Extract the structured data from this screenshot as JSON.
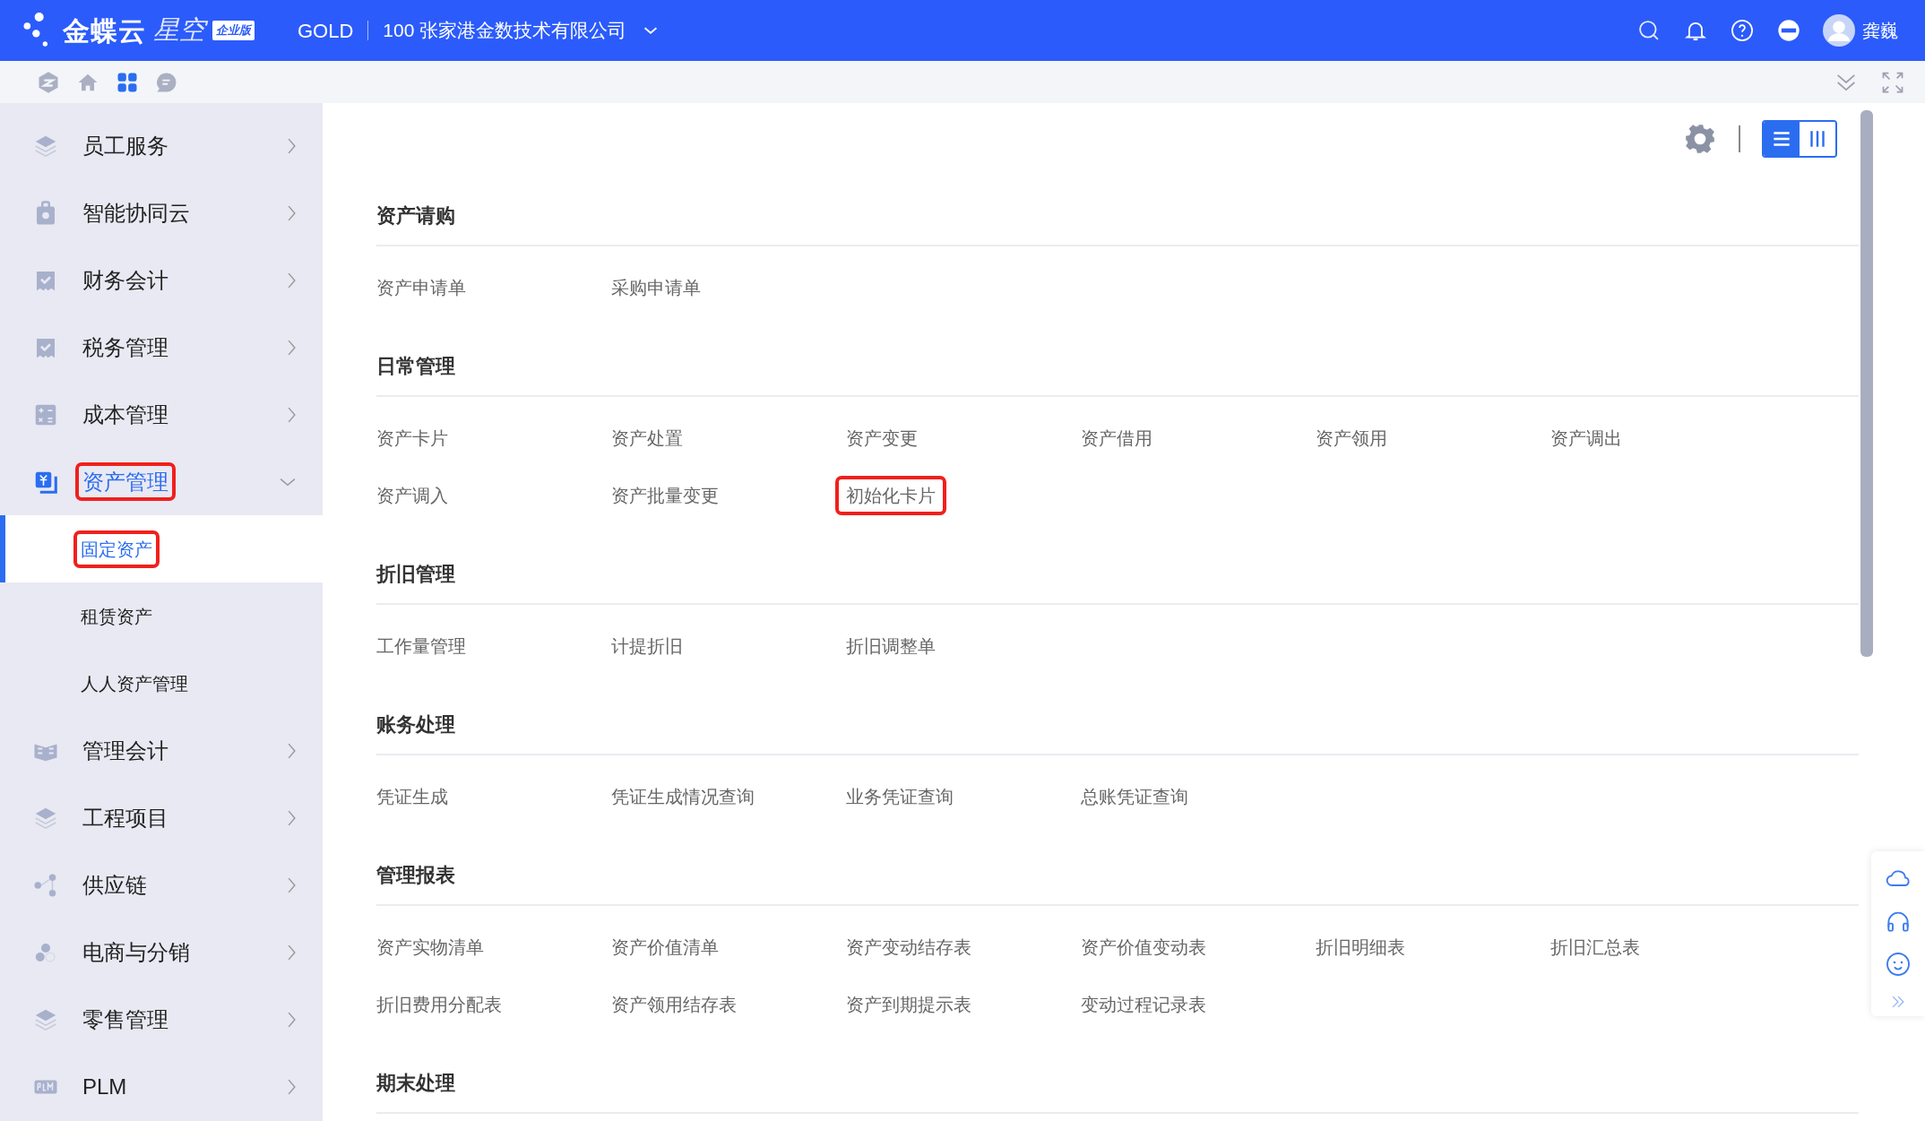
{
  "header": {
    "brand": "金蝶云",
    "product": "星空",
    "edition": "企业版",
    "tier": "GOLD",
    "company": "100 张家港金数技术有限公司",
    "user": "龚巍"
  },
  "sidebar": {
    "items": [
      {
        "label": "员工服务",
        "expanded": false,
        "annotated": false
      },
      {
        "label": "智能协同云",
        "expanded": false,
        "annotated": false
      },
      {
        "label": "财务会计",
        "expanded": false,
        "annotated": false
      },
      {
        "label": "税务管理",
        "expanded": false,
        "annotated": false
      },
      {
        "label": "成本管理",
        "expanded": false,
        "annotated": false
      },
      {
        "label": "资产管理",
        "expanded": true,
        "annotated": true,
        "children": [
          {
            "label": "固定资产",
            "selected": true,
            "annotated": true
          },
          {
            "label": "租赁资产",
            "selected": false,
            "annotated": false
          },
          {
            "label": "人人资产管理",
            "selected": false,
            "annotated": false
          }
        ]
      },
      {
        "label": "管理会计",
        "expanded": false,
        "annotated": false
      },
      {
        "label": "工程项目",
        "expanded": false,
        "annotated": false
      },
      {
        "label": "供应链",
        "expanded": false,
        "annotated": false
      },
      {
        "label": "电商与分销",
        "expanded": false,
        "annotated": false
      },
      {
        "label": "零售管理",
        "expanded": false,
        "annotated": false
      },
      {
        "label": "PLM",
        "expanded": false,
        "annotated": false
      }
    ]
  },
  "view_toggle": [
    {
      "kind": "list",
      "selected": true
    },
    {
      "kind": "columns",
      "selected": false
    }
  ],
  "sections": [
    {
      "title": "资产请购",
      "links": [
        {
          "label": "资产申请单",
          "annotated": false
        },
        {
          "label": "采购申请单",
          "annotated": false
        }
      ]
    },
    {
      "title": "日常管理",
      "links": [
        {
          "label": "资产卡片",
          "annotated": false
        },
        {
          "label": "资产处置",
          "annotated": false
        },
        {
          "label": "资产变更",
          "annotated": false
        },
        {
          "label": "资产借用",
          "annotated": false
        },
        {
          "label": "资产领用",
          "annotated": false
        },
        {
          "label": "资产调出",
          "annotated": false
        },
        {
          "label": "资产调入",
          "annotated": false
        },
        {
          "label": "资产批量变更",
          "annotated": false
        },
        {
          "label": "初始化卡片",
          "annotated": true
        }
      ]
    },
    {
      "title": "折旧管理",
      "links": [
        {
          "label": "工作量管理",
          "annotated": false
        },
        {
          "label": "计提折旧",
          "annotated": false
        },
        {
          "label": "折旧调整单",
          "annotated": false
        }
      ]
    },
    {
      "title": "账务处理",
      "links": [
        {
          "label": "凭证生成",
          "annotated": false
        },
        {
          "label": "凭证生成情况查询",
          "annotated": false
        },
        {
          "label": "业务凭证查询",
          "annotated": false
        },
        {
          "label": "总账凭证查询",
          "annotated": false
        }
      ]
    },
    {
      "title": "管理报表",
      "links": [
        {
          "label": "资产实物清单",
          "annotated": false
        },
        {
          "label": "资产价值清单",
          "annotated": false
        },
        {
          "label": "资产变动结存表",
          "annotated": false
        },
        {
          "label": "资产价值变动表",
          "annotated": false
        },
        {
          "label": "折旧明细表",
          "annotated": false
        },
        {
          "label": "折旧汇总表",
          "annotated": false
        },
        {
          "label": "折旧费用分配表",
          "annotated": false
        },
        {
          "label": "资产领用结存表",
          "annotated": false
        },
        {
          "label": "资产到期提示表",
          "annotated": false
        },
        {
          "label": "变动过程记录表",
          "annotated": false
        }
      ]
    },
    {
      "title": "期末处理"
    }
  ]
}
